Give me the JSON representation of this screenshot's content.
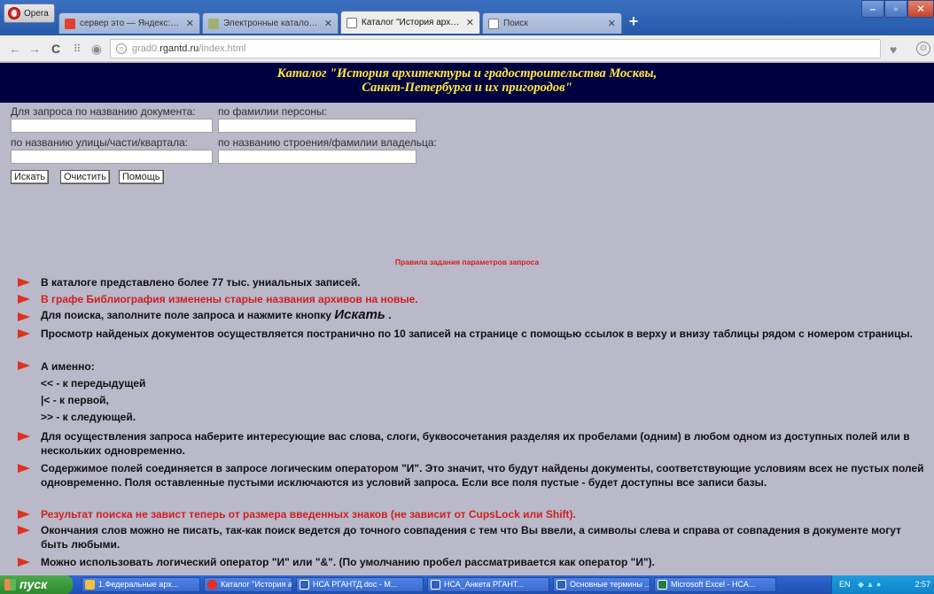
{
  "browser": {
    "app_label": "Opera",
    "tabs": [
      {
        "title": "сервер это — Яндекс: наш",
        "icon_color": "#e04030"
      },
      {
        "title": "Электронные каталоги, б",
        "icon_color": "#a0b070"
      },
      {
        "title": "Каталог \"История архитект",
        "icon_color": "#ffffff"
      },
      {
        "title": "Поиск",
        "icon_color": "#ffffff"
      }
    ],
    "newtab_label": "+",
    "url_host_prefix": "grad0.",
    "url_host_main": "rgantd.ru",
    "url_path": "/index.html"
  },
  "page": {
    "banner_line1": "Каталог \"История архитектуры и градостроительства Москвы,",
    "banner_line2": "Санкт-Петербурга и их пригородов\"",
    "form": {
      "label_doc": "Для запроса по названию документа:",
      "label_person": "по фамилии персоны:",
      "label_street": "по названию улицы/части/квартала:",
      "label_building": "по названию строения/фамилии владельца:",
      "btn_search": "Искать",
      "btn_clear": "Очистить",
      "btn_help": "Помощь"
    },
    "rules_title": "Правила задания параметров запроса",
    "rules": {
      "r1": "В каталоге представлено более 77 тыс. униальных записей.",
      "r2": "В графе Библиография изменены старые названия архивов на новые.",
      "r3_pre": "Для поиска, заполните поле запроса и нажмите кнопку",
      "r3_big": "Искать",
      "r3_post": ".",
      "r4": "Просмотр найденых документов осуществляется постранично по 10 записей на странице с помощью ссылок в верху и внизу таблицы рядом с номером страницы.",
      "r5_l1": "А именно:",
      "r5_l2": "<< - к передыдущей",
      "r5_l3": "|< - к первой,",
      "r5_l4": ">> - к следующей.",
      "r6": "Для осуществления запроса наберите интересующие вас слова, слоги, буквосочетания разделяя их пробелами (одним) в любом одном из доступных полей или в нескольких одновременно.",
      "r7": "Содержимое полей соединяется в запросе логическим оператором \"И\". Это значит, что будут найдены документы, соответствующие условиям всех не пустых полей одновременно. Поля оставленные пустыми исключаются из условий запроса. Если все поля пустые - будет доступны все записи базы.",
      "r8": "Результат поиска не завист теперь от размера введенных знаков (не зависит от CupsLock или Shift).",
      "r9": "Окончания слов можно не писать, так-как поиск ведется до точного совпадения с тем что Вы ввели, а символы слева и справа от совпадения в документе могут быть любыми.",
      "r10": "Можно использовать логический оператор \"И\" или \"&\". (По умолчанию пробел рассматривается как оператор \"И\")."
    }
  },
  "taskbar": {
    "start_label": "пуск",
    "items": [
      {
        "label": "1.Федеральные арх...",
        "icon_color": "#f0c040"
      },
      {
        "label": "Каталог \"История а...",
        "icon_color": "#e03020"
      },
      {
        "label": "НСА РГАНТД.doc - М...",
        "icon_color": "#3060c0"
      },
      {
        "label": "НСА_Анкета РГАНТ...",
        "icon_color": "#3060c0"
      },
      {
        "label": "Основные термины ...",
        "icon_color": "#3060c0"
      },
      {
        "label": "Microsoft Excel - НСА...",
        "icon_color": "#208040"
      }
    ],
    "tray_lang": "EN",
    "tray_time": "2:57"
  },
  "colors": {
    "banner_bg": "#000040",
    "banner_text": "#ffe840",
    "rule_arrow": "#e03020",
    "rule_red": "#d02020"
  }
}
